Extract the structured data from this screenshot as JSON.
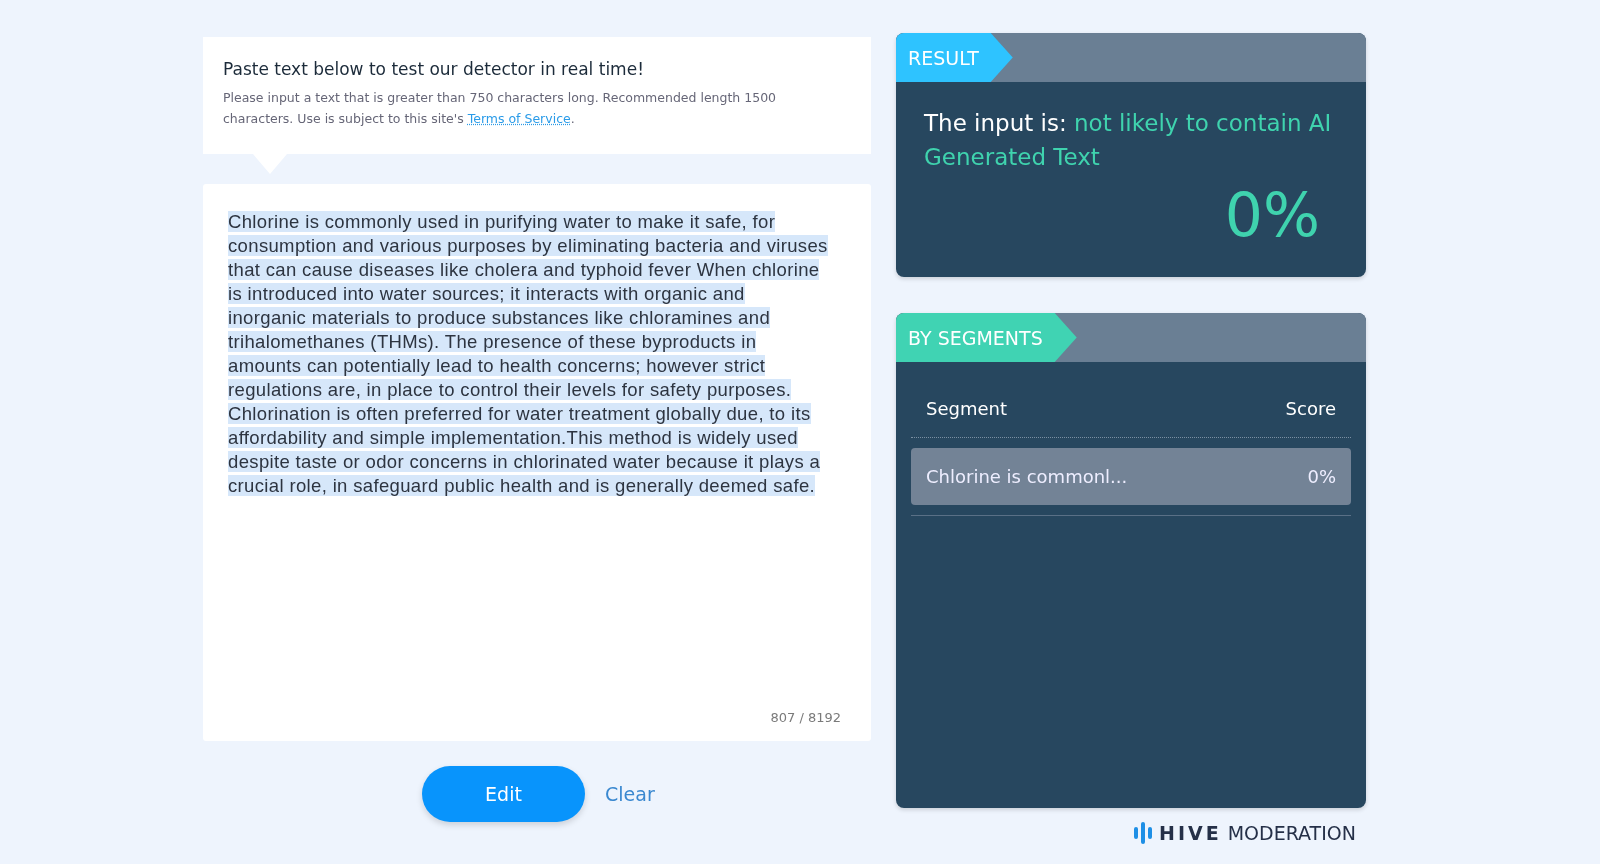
{
  "intro": {
    "title": "Paste text below to test our detector in real time!",
    "note": "Please input a text that is greater than 750 characters long. Recommended length 1500 characters. Use is subject to this site's",
    "link": "Terms of Service",
    "after_link": "."
  },
  "editor": {
    "value": "Chlorine is commonly used in purifying water to make it safe, for consumption and various purposes by eliminating bacteria and viruses that can cause diseases like cholera and typhoid fever When chlorine is introduced into water sources; it interacts with organic and inorganic materials to produce substances like chloramines and trihalomethanes (THMs). The presence of these byproducts in amounts can potentially lead to health concerns; however strict regulations are, in place to control their levels for safety purposes. Chlorination is often preferred for water treatment globally due, to its affordability and simple implementation.This method is widely used despite taste or odor concerns in chlorinated water because it plays a crucial role, in safeguard public health and is generally deemed safe.",
    "selected": true,
    "counter": "807 / 8192"
  },
  "buttons": {
    "edit": "Edit",
    "clear": "Clear"
  },
  "result": {
    "tab": "RESULT",
    "prefix": "The input is:",
    "verdict": "not likely to contain AI Generated Text",
    "score": "0%"
  },
  "segments": {
    "tab": "BY SEGMENTS",
    "columns": [
      "Segment",
      "Score"
    ],
    "rows": [
      {
        "segment": "Chlorine is commonl...",
        "score": "0%",
        "selected": true
      }
    ]
  },
  "footer": {
    "brand": "HIVE",
    "product": "MODERATION"
  }
}
